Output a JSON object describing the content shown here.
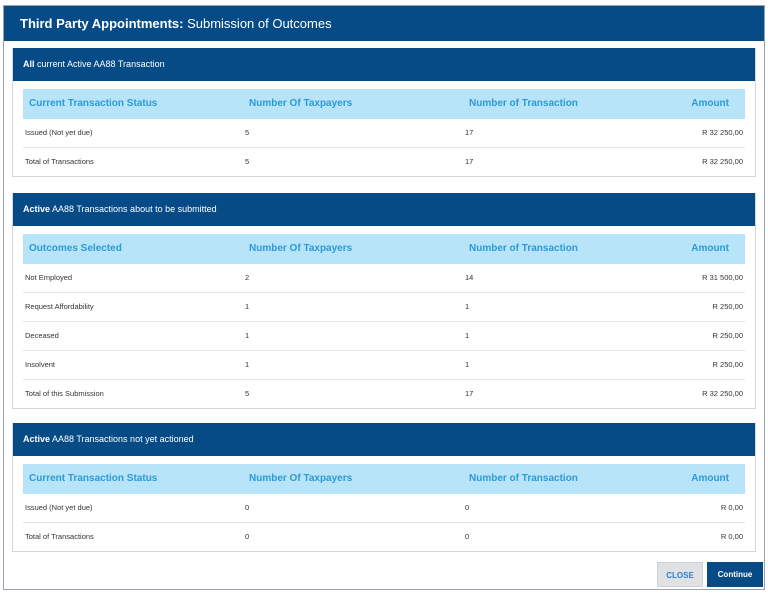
{
  "dialog": {
    "title_bold": "Third Party Appointments:",
    "title_rest": " Submission of Outcomes"
  },
  "sections": [
    {
      "title_bold": "All",
      "title_rest": " current Active AA88 Transaction",
      "columns": [
        "Current Transaction Status",
        "Number Of Taxpayers",
        "Number of Transaction",
        "Amount"
      ],
      "rows": [
        [
          "Issued (Not yet due)",
          "5",
          "17",
          "R 32 250,00"
        ],
        [
          "Total of Transactions",
          "5",
          "17",
          "R 32 250,00"
        ]
      ]
    },
    {
      "title_bold": "Active",
      "title_rest": " AA88 Transactions about to be submitted",
      "columns": [
        "Outcomes Selected",
        "Number Of Taxpayers",
        "Number of Transaction",
        "Amount"
      ],
      "rows": [
        [
          "Not Employed",
          "2",
          "14",
          "R 31 500,00"
        ],
        [
          "Request Affordability",
          "1",
          "1",
          "R 250,00"
        ],
        [
          "Deceased",
          "1",
          "1",
          "R 250,00"
        ],
        [
          "Insolvent",
          "1",
          "1",
          "R 250,00"
        ],
        [
          "Total of this Submission",
          "5",
          "17",
          "R 32 250,00"
        ]
      ]
    },
    {
      "title_bold": "Active",
      "title_rest": " AA88 Transactions not yet actioned",
      "columns": [
        "Current Transaction Status",
        "Number Of Taxpayers",
        "Number of Transaction",
        "Amount"
      ],
      "rows": [
        [
          "Issued (Not yet due)",
          "0",
          "0",
          "R 0,00"
        ],
        [
          "Total of Transactions",
          "0",
          "0",
          "R 0,00"
        ]
      ]
    }
  ],
  "buttons": {
    "close_label": "CLOSE",
    "continue_label": "Continue"
  }
}
